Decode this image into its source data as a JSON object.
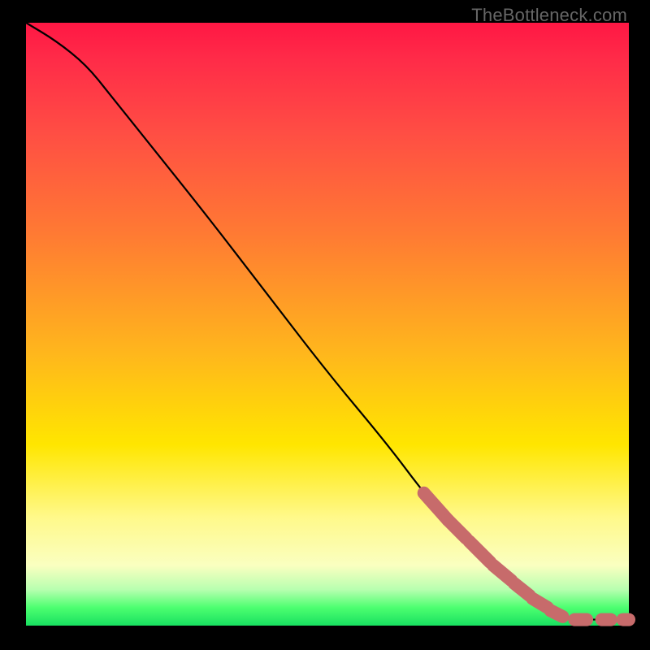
{
  "watermark": "TheBottleneck.com",
  "colors": {
    "bg": "#000000",
    "line": "#000000",
    "marker": "#c76b6b",
    "gradient_top": "#ff1744",
    "gradient_bottom": "#18e060"
  },
  "chart_data": {
    "type": "line",
    "title": "",
    "xlabel": "",
    "ylabel": "",
    "xlim": [
      0,
      100
    ],
    "ylim": [
      0,
      100
    ],
    "grid": false,
    "legend": false,
    "line_points": [
      {
        "x": 0,
        "y": 100
      },
      {
        "x": 5,
        "y": 97
      },
      {
        "x": 10,
        "y": 93
      },
      {
        "x": 14,
        "y": 88
      },
      {
        "x": 20,
        "y": 80.5
      },
      {
        "x": 30,
        "y": 68
      },
      {
        "x": 40,
        "y": 55
      },
      {
        "x": 50,
        "y": 42
      },
      {
        "x": 60,
        "y": 30
      },
      {
        "x": 66,
        "y": 22
      },
      {
        "x": 70,
        "y": 17.5
      },
      {
        "x": 74,
        "y": 13.5
      },
      {
        "x": 78,
        "y": 10
      },
      {
        "x": 82,
        "y": 6.5
      },
      {
        "x": 86,
        "y": 3.5
      },
      {
        "x": 89,
        "y": 1.5
      },
      {
        "x": 92,
        "y": 1
      },
      {
        "x": 96,
        "y": 1
      },
      {
        "x": 100,
        "y": 1
      }
    ],
    "marker_segments": [
      {
        "x1": 66,
        "y1": 22,
        "x2": 70,
        "y2": 17.5
      },
      {
        "x1": 70,
        "y1": 17.5,
        "x2": 73,
        "y2": 14.5
      },
      {
        "x1": 73.5,
        "y1": 14,
        "x2": 77,
        "y2": 10.5
      },
      {
        "x1": 77.5,
        "y1": 10,
        "x2": 80.5,
        "y2": 7.5
      },
      {
        "x1": 81,
        "y1": 7,
        "x2": 83.5,
        "y2": 5
      },
      {
        "x1": 84,
        "y1": 4.5,
        "x2": 86.5,
        "y2": 3
      },
      {
        "x1": 87,
        "y1": 2.5,
        "x2": 89,
        "y2": 1.5
      },
      {
        "x1": 91,
        "y1": 1,
        "x2": 93,
        "y2": 1
      },
      {
        "x1": 95.5,
        "y1": 1,
        "x2": 97,
        "y2": 1
      },
      {
        "x1": 99,
        "y1": 1,
        "x2": 100,
        "y2": 1
      }
    ],
    "marker_radius_px": 8
  }
}
